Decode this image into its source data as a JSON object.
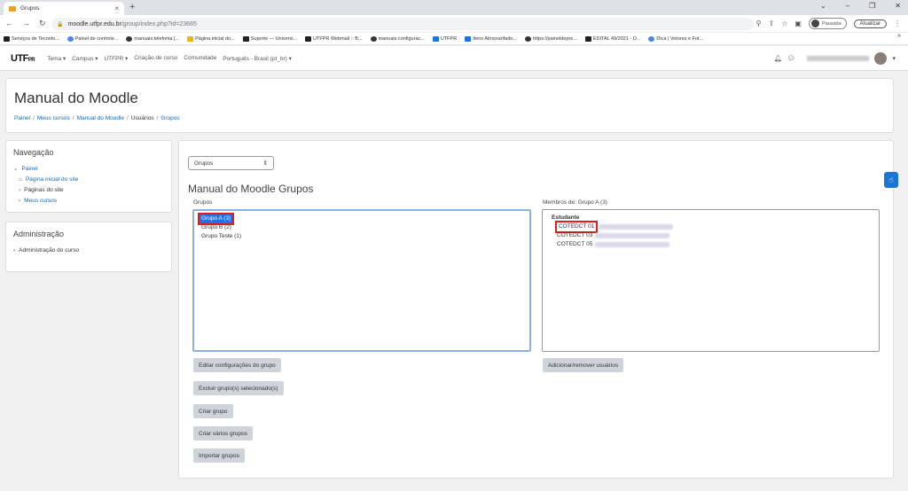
{
  "browser": {
    "tab_title": "Grupos",
    "url_host": "moodle.utfpr.edu.br",
    "url_path": "/group/index.php?id=23665",
    "profile_label": "Pausada",
    "update_label": "Atualizar"
  },
  "bookmarks": [
    {
      "label": "Serviços de Tecnolo...",
      "icon": "utf-icon"
    },
    {
      "label": "Painel de controle...",
      "icon": "google-icon"
    },
    {
      "label": "manuais:telefonia [...",
      "icon": "github-icon"
    },
    {
      "label": "Página inicial do...",
      "icon": "home-icon"
    },
    {
      "label": "Suporte — Universi...",
      "icon": "utf-icon"
    },
    {
      "label": "UTFPR Webmail :: B...",
      "icon": "utf-icon"
    },
    {
      "label": "manuais:configurac...",
      "icon": "github-icon"
    },
    {
      "label": "UTFPR",
      "icon": "blue-icon"
    },
    {
      "label": "Itens Almoxarifado...",
      "icon": "blue-icon"
    },
    {
      "label": "https://paineldepre...",
      "icon": "github-icon"
    },
    {
      "label": "EDITAL 49/2021 - D...",
      "icon": "utf-icon"
    },
    {
      "label": "Dica | Vetores e Fot...",
      "icon": "star-icon"
    }
  ],
  "moodle_nav": {
    "logo": "UTF",
    "logo_small": "PR",
    "items": [
      "Tema ▾",
      "Campus ▾",
      "UTFPR ▾",
      "Criação de curso",
      "Comunidade",
      "Português - Brasil (pt_br) ▾"
    ]
  },
  "header": {
    "title": "Manual do Moodle",
    "breadcrumb": [
      "Painel",
      "Meus cursos",
      "Manual do Moodle",
      "Usuários",
      "Grupos"
    ]
  },
  "navigation_block": {
    "title": "Navegação",
    "root": "Painel",
    "items": [
      "Página inicial do site",
      "Páginas do site",
      "Meus cursos"
    ]
  },
  "admin_block": {
    "title": "Administração",
    "items": [
      "Administração do curso"
    ]
  },
  "main": {
    "select_value": "Grupos",
    "heading": "Manual do Moodle Grupos",
    "groups_label": "Grupos",
    "members_label": "Membros de: Grupo A (3)",
    "groups": [
      "Grupo A (3)",
      "Grupo B (2)",
      "Grupo Teste (1)"
    ],
    "selected_group_index": 0,
    "member_role": "Estudante",
    "members": [
      "COTEDCT 01",
      "COTEDCT 03",
      "COTEDCT 05"
    ],
    "buttons": {
      "edit": "Editar configurações do grupo",
      "delete": "Excluir grupo(s) selecionado(s)",
      "create": "Criar grupo",
      "create_many": "Criar vários grupos",
      "import": "Importar grupos",
      "add_remove": "Adicionar/remover usuários"
    }
  },
  "colors": {
    "link": "#0f6cbf",
    "selection": "#1e73e8",
    "highlight": "#e51a1a",
    "button": "#ced4da"
  }
}
